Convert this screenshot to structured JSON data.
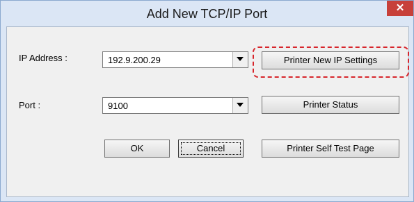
{
  "window": {
    "title": "Add New TCP/IP Port",
    "close_glyph": "✕"
  },
  "fields": {
    "ip_label": "IP Address :",
    "ip_value": "192.9.200.29",
    "port_label": "Port :",
    "port_value": "9100"
  },
  "buttons": {
    "printer_new_ip": "Printer New IP Settings",
    "printer_status": "Printer Status",
    "ok": "OK",
    "cancel": "Cancel",
    "self_test": "Printer Self Test Page"
  },
  "colors": {
    "highlight": "#d7252b",
    "close_bg": "#c7403a"
  }
}
